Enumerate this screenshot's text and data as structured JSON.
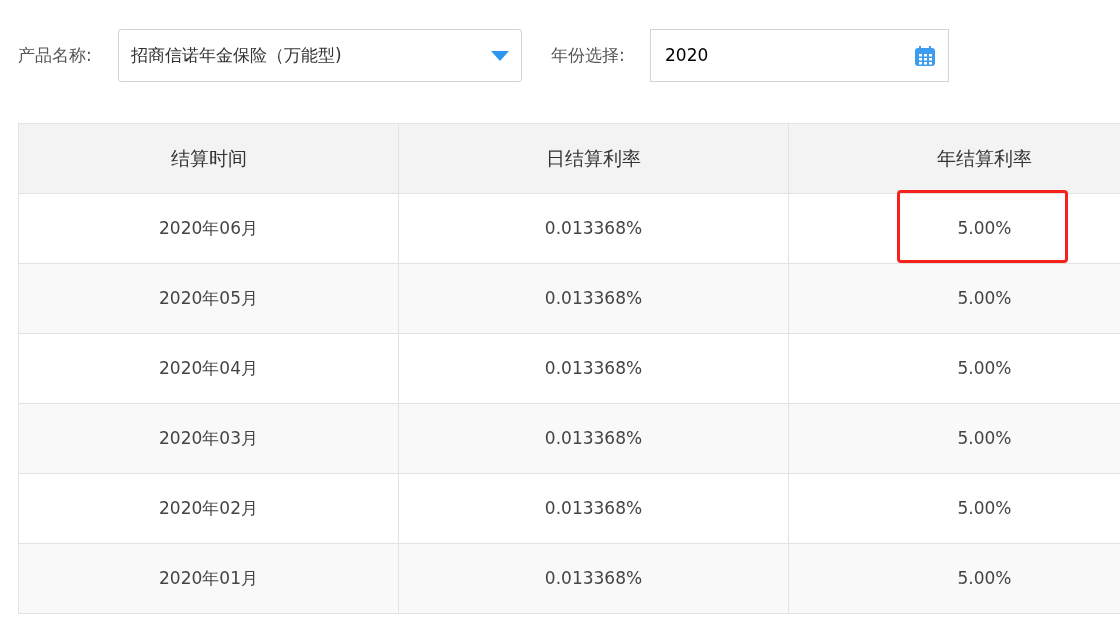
{
  "filters": {
    "product": {
      "label": "产品名称:",
      "value": "招商信诺年金保险（万能型)"
    },
    "year": {
      "label": "年份选择:",
      "value": "2020"
    }
  },
  "table": {
    "columns": [
      "结算时间",
      "日结算利率",
      "年结算利率"
    ],
    "rows": [
      {
        "cells": [
          "2020年06月",
          "0.013368%",
          "5.00%"
        ],
        "highlighted": true
      },
      {
        "cells": [
          "2020年05月",
          "0.013368%",
          "5.00%"
        ],
        "highlighted": false
      },
      {
        "cells": [
          "2020年04月",
          "0.013368%",
          "5.00%"
        ],
        "highlighted": false
      },
      {
        "cells": [
          "2020年03月",
          "0.013368%",
          "5.00%"
        ],
        "highlighted": false
      },
      {
        "cells": [
          "2020年02月",
          "0.013368%",
          "5.00%"
        ],
        "highlighted": false
      },
      {
        "cells": [
          "2020年01月",
          "0.013368%",
          "5.00%"
        ],
        "highlighted": false
      }
    ]
  }
}
